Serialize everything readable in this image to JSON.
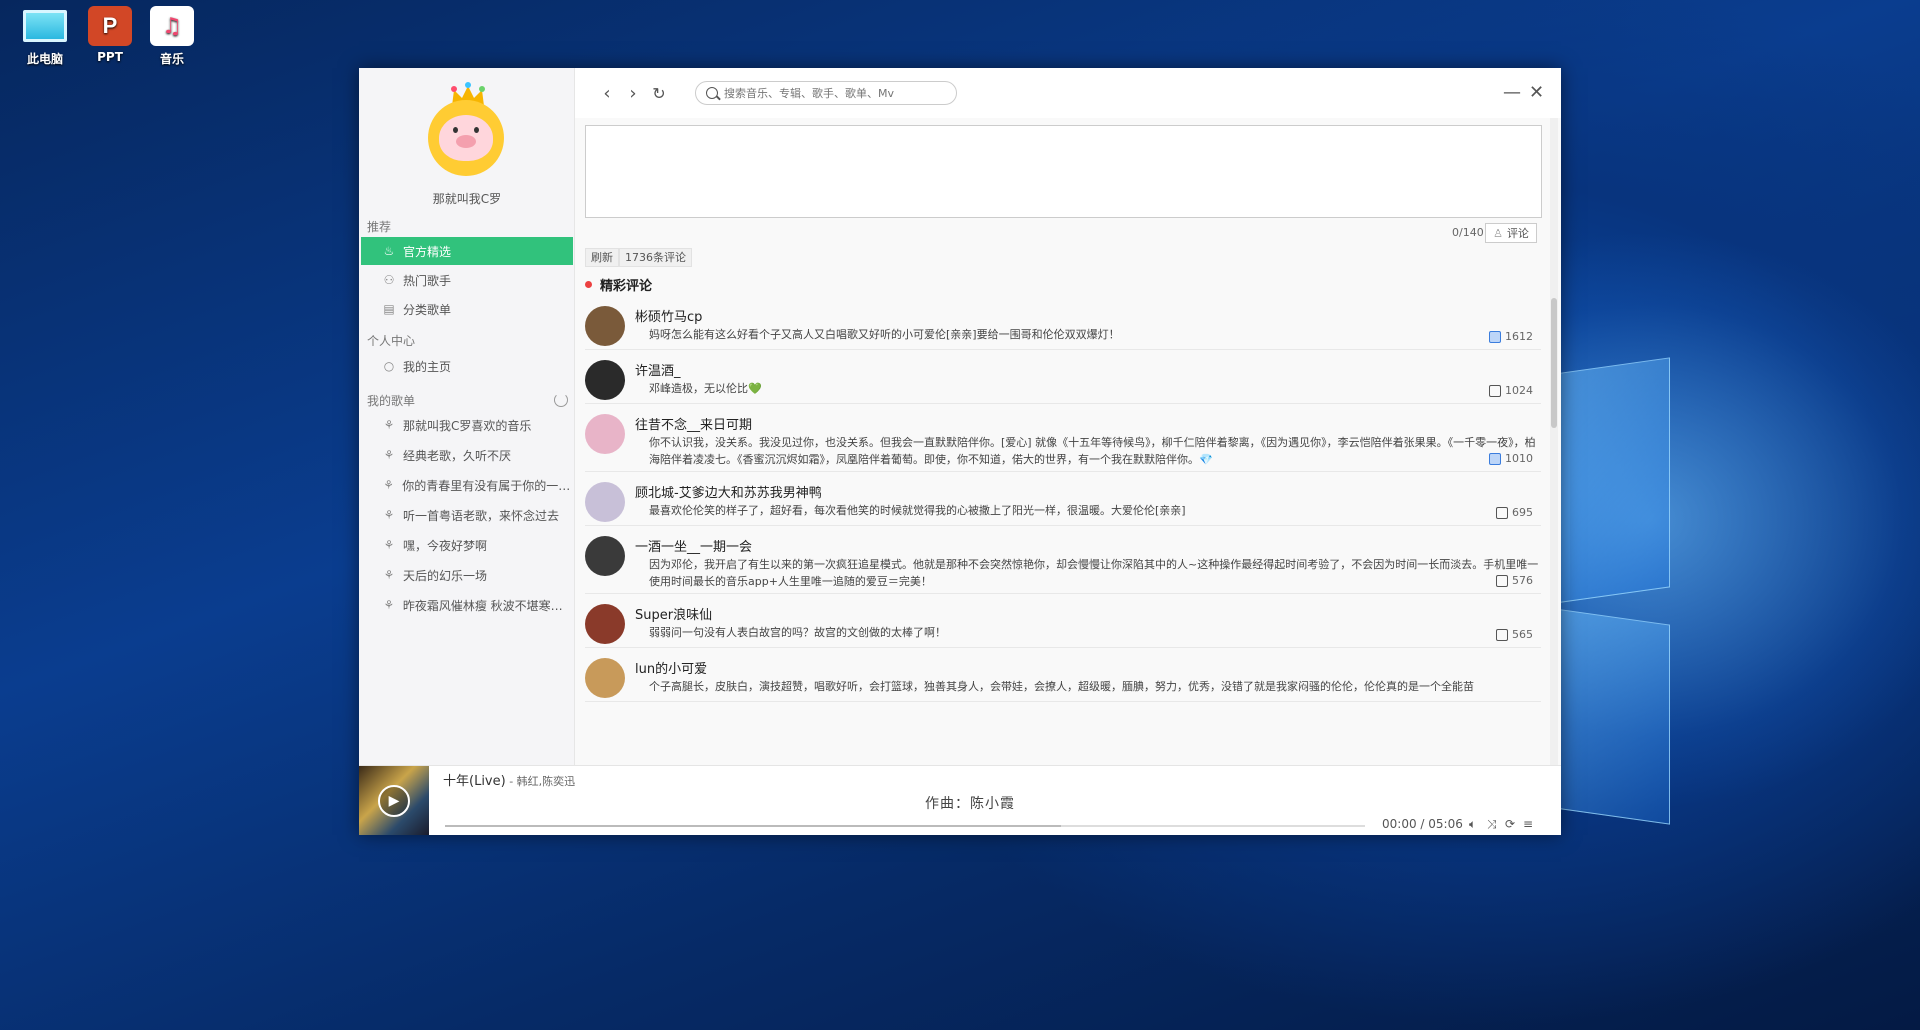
{
  "desktop": {
    "icons": [
      {
        "label": "此电脑"
      },
      {
        "label": "PPT"
      },
      {
        "label": "音乐"
      }
    ]
  },
  "sidebar": {
    "username": "那就叫我C罗",
    "section_recommend": "推荐",
    "recommend_items": [
      {
        "label": "官方精选",
        "icon": "fire-icon"
      },
      {
        "label": "热门歌手",
        "icon": "user-icon"
      },
      {
        "label": "分类歌单",
        "icon": "list-icon"
      }
    ],
    "section_personal": "个人中心",
    "personal_items": [
      {
        "label": "我的主页",
        "icon": "home-icon"
      }
    ],
    "section_playlists": "我的歌单",
    "playlists": [
      {
        "label": "那就叫我C罗喜欢的音乐"
      },
      {
        "label": "经典老歌，久听不厌"
      },
      {
        "label": "你的青春里有没有属于你的一首歌"
      },
      {
        "label": "听一首粤语老歌，来怀念过去"
      },
      {
        "label": "嘿，今夜好梦啊"
      },
      {
        "label": "天后的幻乐一场"
      },
      {
        "label": "昨夜霜风催林瘦 秋波不堪寒梧冷"
      }
    ]
  },
  "header": {
    "back": "‹",
    "forward": "›",
    "refresh": "↻",
    "search_placeholder": "搜索音乐、专辑、歌手、歌单、Mv",
    "minimize": "—",
    "close": "✕"
  },
  "content": {
    "char_count": "0/140",
    "submit_label": "评论",
    "refresh_tag": "刷新",
    "comment_count_tag": "1736条评论",
    "hot_title": "精彩评论",
    "comments": [
      {
        "user": "彬硕竹马cp",
        "text": "妈呀怎么能有这么好看个子又高人又白唱歌又好听的小可爱伦[亲亲]要给一围哥和伦伦双双爆灯！",
        "likes": "1612",
        "liked": true,
        "avatar_color": "#7a5a3a"
      },
      {
        "user": "许温酒_",
        "text": "邓峰造极，无以伦比💚",
        "likes": "1024",
        "liked": false,
        "avatar_color": "#2a2a2a"
      },
      {
        "user": "往昔不念__来日可期",
        "text": "你不认识我，没关系。我没见过你，也没关系。但我会一直默默陪伴你。[爱心] 就像《十五年等待候鸟》，柳千仁陪伴着黎离，《因为遇见你》，李云恺陪伴着张果果。《一千零一夜》，柏海陪伴着凌凌七。《香蜜沉沉烬如霜》，凤凰陪伴着葡萄。即使，你不知道，偌大的世界，有一个我在默默陪伴你。💎",
        "likes": "1010",
        "liked": true,
        "avatar_color": "#e8b4c8"
      },
      {
        "user": "顾北城-艾爹边大和苏苏我男神鸭",
        "text": "最喜欢伦伦笑的样子了，超好看，每次看他笑的时候就觉得我的心被撒上了阳光一样，很温暖。大爱伦伦[亲亲]",
        "likes": "695",
        "liked": false,
        "avatar_color": "#c8c0d8"
      },
      {
        "user": "一酒一坐__一期一会",
        "text": "因为邓伦，我开启了有生以来的第一次疯狂追星模式。他就是那种不会突然惊艳你，却会慢慢让你深陷其中的人~这种操作最经得起时间考验了，不会因为时间一长而淡去。手机里唯一使用时间最长的音乐app+人生里唯一追随的爱豆＝完美！",
        "likes": "576",
        "liked": false,
        "avatar_color": "#3a3a3a"
      },
      {
        "user": "Super浪味仙",
        "text": "弱弱问一句没有人表白故宫的吗？故宫的文创做的太棒了啊！",
        "likes": "565",
        "liked": false,
        "avatar_color": "#8a3a2a"
      },
      {
        "user": "lun的小可爱",
        "text": "个子高腿长，皮肤白，演技超赞，唱歌好听，会打篮球，独善其身人，会带娃，会撩人，超级暖，腼腆，努力，优秀，没错了就是我家闷骚的伦伦，伦伦真的是一个全能苗",
        "likes": "",
        "liked": false,
        "avatar_color": "#c89a5a"
      }
    ]
  },
  "player": {
    "song_title": "十年(Live)",
    "artist": " - 韩红,陈奕迅",
    "lyric": "作曲：陈小霞",
    "time": "00:00 / 05:06",
    "progress": 0.67
  }
}
